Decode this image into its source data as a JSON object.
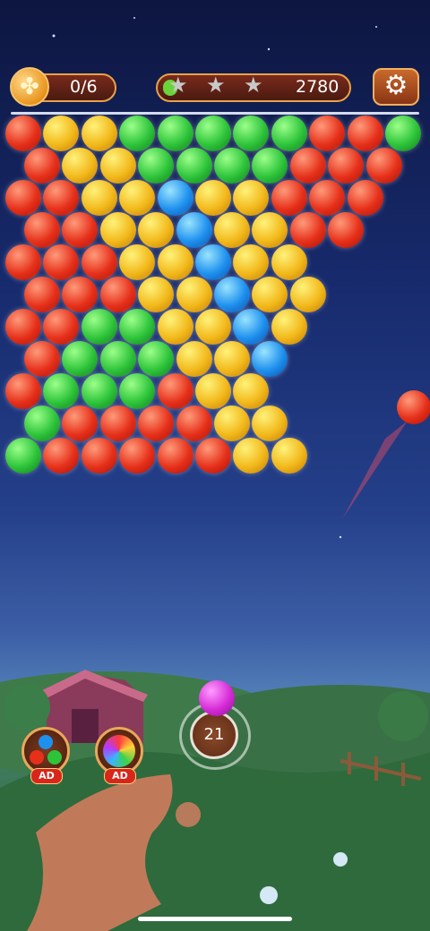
{
  "clover_counter": "0/6",
  "score": "2780",
  "stars_total": 3,
  "shots_left": "21",
  "boosters": [
    {
      "name": "color-swap-booster",
      "badge": "AD"
    },
    {
      "name": "rainbow-booster",
      "badge": "AD"
    }
  ],
  "colors": {
    "red": "#e6301a",
    "yellow": "#f2b81a",
    "green": "#2dc43a",
    "blue": "#1e90ee",
    "magenta": "#d62cd6"
  },
  "icons": [
    "clover-icon",
    "star-icon",
    "gear-icon"
  ],
  "grid_rows": [
    "RYYGGGGGRRG",
    "RYYGGGGRRR",
    "RRYYBYYRRR",
    "RRYYBYYRR",
    "RRRYYBYY",
    "RRRYYBYY",
    "RRGGYYBY",
    "RGGGYYB",
    "RGGGRYY",
    "GRRRRYY",
    "GRRRRRYY"
  ],
  "aim_ball": "R",
  "next_ball": "magenta"
}
